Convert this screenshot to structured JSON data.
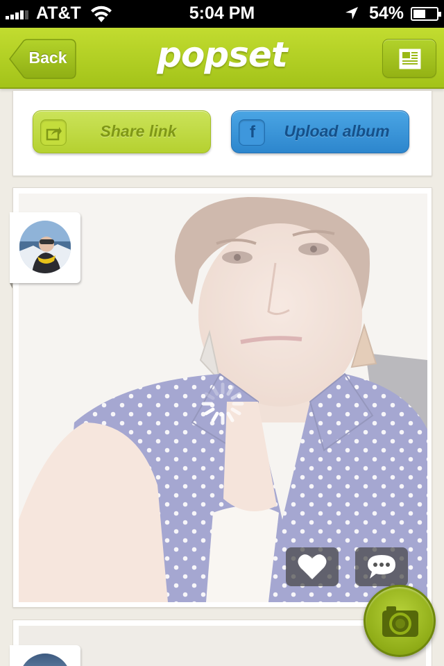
{
  "status_bar": {
    "carrier": "AT&T",
    "time": "5:04 PM",
    "battery_percent_label": "54%",
    "battery_level": 0.54,
    "signal_bars": 4,
    "icons": [
      "signal-icon",
      "wifi-icon",
      "location-arrow-icon",
      "battery-icon"
    ]
  },
  "nav": {
    "back_label": "Back",
    "title": "popset",
    "feed_icon": "newspaper-icon"
  },
  "actions": {
    "share_label": "Share link",
    "share_icon": "share-icon",
    "upload_label": "Upload album",
    "upload_icon_letter": "f"
  },
  "photo_card": {
    "like_icon": "heart-icon",
    "comment_icon": "speech-bubble-icon",
    "loading": true
  },
  "fab": {
    "icon": "camera-icon"
  },
  "colors": {
    "brand_green": "#a8c61c",
    "facebook_blue": "#2f8ad0",
    "background": "#efece4"
  }
}
